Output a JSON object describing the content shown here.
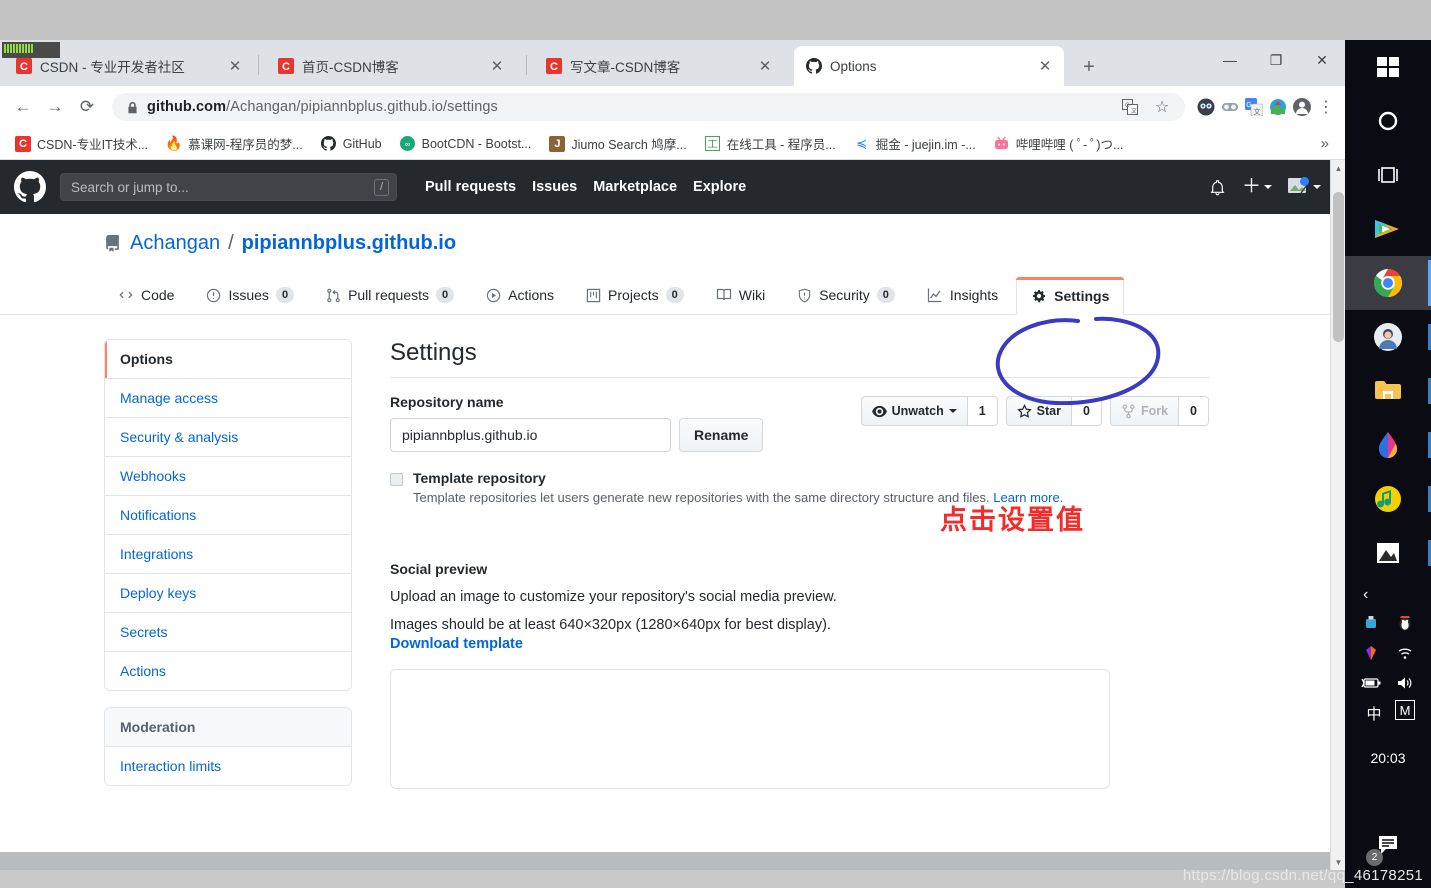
{
  "browser": {
    "tabs": [
      {
        "title": "CSDN - 专业开发者社区",
        "favicon": "csdn-icon",
        "active": false
      },
      {
        "title": "首页-CSDN博客",
        "favicon": "csdn-icon",
        "active": false
      },
      {
        "title": "写文章-CSDN博客",
        "favicon": "csdn-icon",
        "active": false
      },
      {
        "title": "Options",
        "favicon": "github-icon",
        "active": true
      }
    ],
    "new_tab_label": "+",
    "window_controls": {
      "minimize": "—",
      "maximize": "❐",
      "close": "✕"
    },
    "url_host": "github.com",
    "url_path": "/Achangan/pipiannbplus.github.io/settings",
    "bookmarks": [
      {
        "label": "CSDN-专业IT技术...",
        "icon": "csdn-icon"
      },
      {
        "label": "慕课网-程序员的梦...",
        "icon": "flame-icon"
      },
      {
        "label": "GitHub",
        "icon": "github-icon"
      },
      {
        "label": "BootCDN - Bootst...",
        "icon": "bootcdn-icon"
      },
      {
        "label": "Jiumo Search 鸠摩...",
        "icon": "jiumo-icon"
      },
      {
        "label": "在线工具 - 程序员...",
        "icon": "tool-icon"
      },
      {
        "label": "掘金 - juejin.im -...",
        "icon": "juejin-icon"
      },
      {
        "label": "哔哩哔哩 ( ﾟ- ﾟ)つ...",
        "icon": "bilibili-icon"
      }
    ],
    "bookmarks_overflow": "»"
  },
  "github": {
    "search_placeholder": "Search or jump to...",
    "search_shortcut": "/",
    "nav": [
      "Pull requests",
      "Issues",
      "Marketplace",
      "Explore"
    ],
    "repo": {
      "owner": "Achangan",
      "separator": "/",
      "name": "pipiannbplus.github.io",
      "actions": [
        {
          "label": "Unwatch",
          "count": "1",
          "icon": "eye-icon",
          "has_caret": true,
          "disabled": false
        },
        {
          "label": "Star",
          "count": "0",
          "icon": "star-icon",
          "has_caret": false,
          "disabled": false
        },
        {
          "label": "Fork",
          "count": "0",
          "icon": "fork-icon",
          "has_caret": false,
          "disabled": true
        }
      ]
    },
    "tabs": [
      {
        "label": "Code",
        "icon": "code-icon",
        "count": null,
        "selected": false
      },
      {
        "label": "Issues",
        "icon": "issue-icon",
        "count": "0",
        "selected": false
      },
      {
        "label": "Pull requests",
        "icon": "pullrequest-icon",
        "count": "0",
        "selected": false
      },
      {
        "label": "Actions",
        "icon": "play-icon",
        "count": null,
        "selected": false
      },
      {
        "label": "Projects",
        "icon": "project-icon",
        "count": "0",
        "selected": false
      },
      {
        "label": "Wiki",
        "icon": "book-icon",
        "count": null,
        "selected": false
      },
      {
        "label": "Security",
        "icon": "shield-icon",
        "count": "0",
        "selected": false
      },
      {
        "label": "Insights",
        "icon": "graph-icon",
        "count": null,
        "selected": false
      },
      {
        "label": "Settings",
        "icon": "gear-icon",
        "count": null,
        "selected": true
      }
    ],
    "sidebar": {
      "primary": [
        {
          "label": "Options",
          "selected": true
        },
        {
          "label": "Manage access",
          "selected": false
        },
        {
          "label": "Security & analysis",
          "selected": false
        },
        {
          "label": "Webhooks",
          "selected": false
        },
        {
          "label": "Notifications",
          "selected": false
        },
        {
          "label": "Integrations",
          "selected": false
        },
        {
          "label": "Deploy keys",
          "selected": false
        },
        {
          "label": "Secrets",
          "selected": false
        },
        {
          "label": "Actions",
          "selected": false
        }
      ],
      "moderation_title": "Moderation",
      "moderation": [
        {
          "label": "Interaction limits"
        }
      ]
    },
    "settings": {
      "page_title": "Settings",
      "repo_name_label": "Repository name",
      "repo_name_value": "pipiannbplus.github.io",
      "rename_button": "Rename",
      "template_repo_label": "Template repository",
      "template_repo_desc": "Template repositories let users generate new repositories with the same directory structure and files.",
      "template_repo_learn_more": "Learn more.",
      "social_preview_title": "Social preview",
      "social_preview_p1": "Upload an image to customize your repository's social media preview.",
      "social_preview_p2": "Images should be at least 640×320px (1280×640px for best display).",
      "download_template": "Download template"
    }
  },
  "annotations": {
    "red_text": "点击设置值",
    "circle_target": "Settings tab"
  },
  "taskbar": {
    "items": [
      {
        "name": "start-button",
        "icon": "windows-icon",
        "state": ""
      },
      {
        "name": "cortana-search",
        "icon": "circle-icon",
        "state": ""
      },
      {
        "name": "task-view",
        "icon": "taskview-icon",
        "state": ""
      },
      {
        "name": "potplayer",
        "icon": "player-icon",
        "state": ""
      },
      {
        "name": "chrome",
        "icon": "chrome-icon",
        "state": "active"
      },
      {
        "name": "qq",
        "icon": "avatar-icon",
        "state": "running"
      },
      {
        "name": "file-explorer",
        "icon": "folder-icon",
        "state": "running"
      },
      {
        "name": "photoshop",
        "icon": "drop-icon",
        "state": "running"
      },
      {
        "name": "qq-music",
        "icon": "music-icon",
        "state": "running"
      },
      {
        "name": "image-viewer",
        "icon": "picture-icon",
        "state": "running"
      }
    ],
    "tray_chevron": "‹",
    "tray_icons": [
      "usb-icon",
      "qq-penguin-icon",
      "gem-icon",
      "wifi-icon",
      "battery-icon",
      "volume-icon"
    ],
    "ime": {
      "lang": "中",
      "mode": "M"
    },
    "clock": "20:03",
    "notification_count": "2"
  },
  "watermark": "https://blog.csdn.net/qq_46178251",
  "colors": {
    "github_header": "#24292e",
    "github_link": "#0366d6",
    "accent_orange": "#f9826c",
    "annotation_red": "#f22b2b",
    "annotation_blue": "#3b3bbf",
    "taskbar": "#0b0b14"
  }
}
